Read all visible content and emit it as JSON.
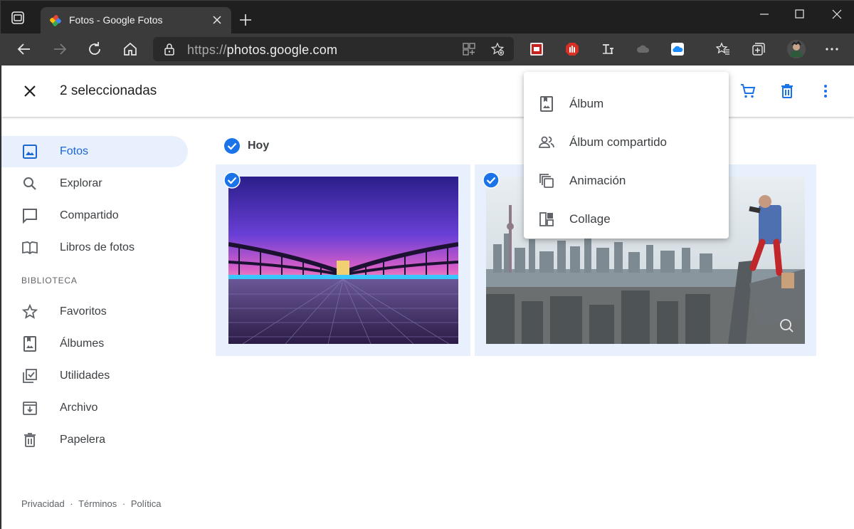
{
  "browser": {
    "tab_title": "Fotos - Google Fotos",
    "url_scheme": "https://",
    "url_host": "photos.google.com"
  },
  "toolbar": {
    "selection_count": "2 seleccionadas"
  },
  "menu": {
    "items": [
      {
        "label": "Álbum",
        "icon": "album-icon"
      },
      {
        "label": "Álbum compartido",
        "icon": "shared-album-icon"
      },
      {
        "label": "Animación",
        "icon": "animation-icon"
      },
      {
        "label": "Collage",
        "icon": "collage-icon"
      }
    ]
  },
  "sidebar": {
    "items": [
      {
        "label": "Fotos",
        "icon": "photo-icon",
        "active": true
      },
      {
        "label": "Explorar",
        "icon": "search-icon"
      },
      {
        "label": "Compartido",
        "icon": "chat-icon"
      },
      {
        "label": "Libros de fotos",
        "icon": "book-icon"
      }
    ],
    "section_title": "BIBLIOTECA",
    "library": [
      {
        "label": "Favoritos",
        "icon": "star-icon"
      },
      {
        "label": "Álbumes",
        "icon": "album-icon"
      },
      {
        "label": "Utilidades",
        "icon": "utilities-icon"
      },
      {
        "label": "Archivo",
        "icon": "archive-icon"
      },
      {
        "label": "Papelera",
        "icon": "trash-icon"
      }
    ]
  },
  "content": {
    "date_label": "Hoy"
  },
  "footer": {
    "privacy": "Privacidad",
    "terms": "Términos",
    "policy": "Política",
    "separator": "·"
  },
  "colors": {
    "accent": "#1a73e8",
    "selected_bg": "#e8f0fe"
  }
}
